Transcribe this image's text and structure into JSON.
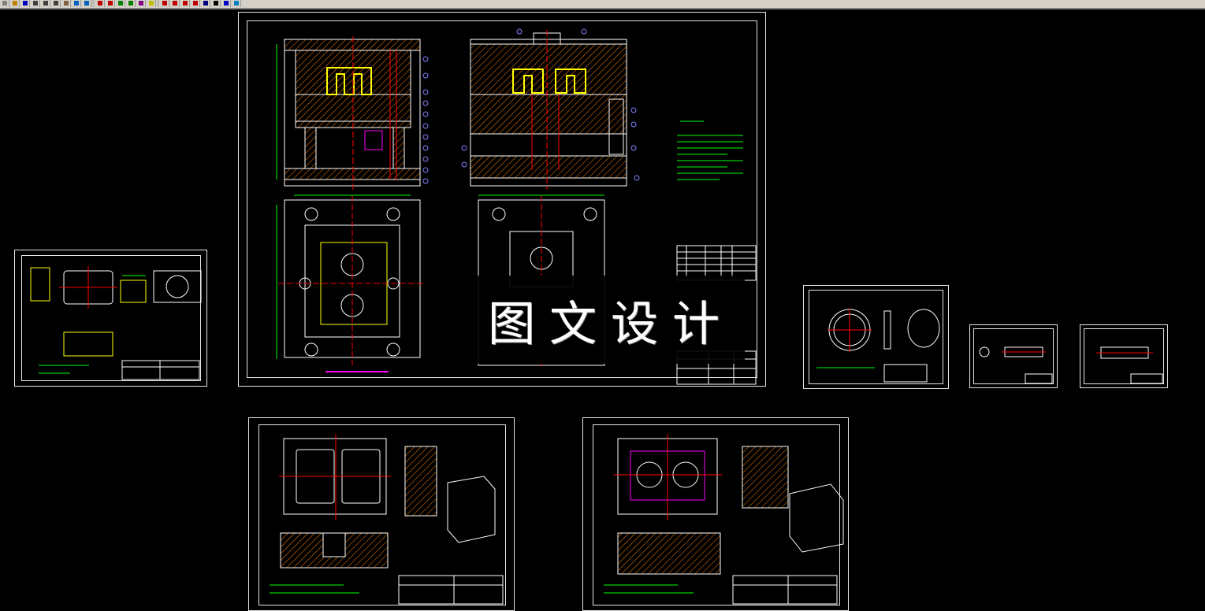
{
  "app": {
    "toolbar_buttons": [
      {
        "name": "new-icon",
        "color": "#808080"
      },
      {
        "name": "open-icon",
        "color": "#c08000"
      },
      {
        "name": "save-icon",
        "color": "#0000c0"
      },
      {
        "name": "print-icon",
        "color": "#404040"
      },
      {
        "name": "cut-icon",
        "color": "#404040"
      },
      {
        "name": "copy-icon",
        "color": "#404040"
      },
      {
        "name": "paste-icon",
        "color": "#806040"
      },
      {
        "name": "undo-icon",
        "color": "#0060c0"
      },
      {
        "name": "redo-icon",
        "color": "#0060c0"
      },
      {
        "name": "pan-icon",
        "color": "#c00000"
      },
      {
        "name": "zoom-icon",
        "color": "#c00000"
      },
      {
        "name": "zoom-window-icon",
        "color": "#008000"
      },
      {
        "name": "zoom-previous-icon",
        "color": "#008000"
      },
      {
        "name": "properties-icon",
        "color": "#800080"
      },
      {
        "name": "layer-icon",
        "color": "#c0c000"
      },
      {
        "name": "line-icon",
        "color": "#c00000"
      },
      {
        "name": "polyline-icon",
        "color": "#c00000"
      },
      {
        "name": "circle-icon",
        "color": "#c00000"
      },
      {
        "name": "arc-icon",
        "color": "#c00000"
      },
      {
        "name": "hatch-icon",
        "color": "#000080"
      },
      {
        "name": "text-icon",
        "color": "#000000"
      },
      {
        "name": "dimension-icon",
        "color": "#0000c0"
      },
      {
        "name": "help-icon",
        "color": "#0080c0"
      }
    ]
  },
  "watermark": {
    "text": "图文设计"
  },
  "colors": {
    "background": "#000000",
    "border": "#e6e6e6",
    "outline": "#ffffff",
    "centerline": "#ff0000",
    "dimension": "#00ff00",
    "part": "#ffff00",
    "hatch": "#ff8000",
    "leader": "#0000ff",
    "balloon": "#8080ff",
    "aux": "#00ffff",
    "magenta": "#ff00ff"
  }
}
